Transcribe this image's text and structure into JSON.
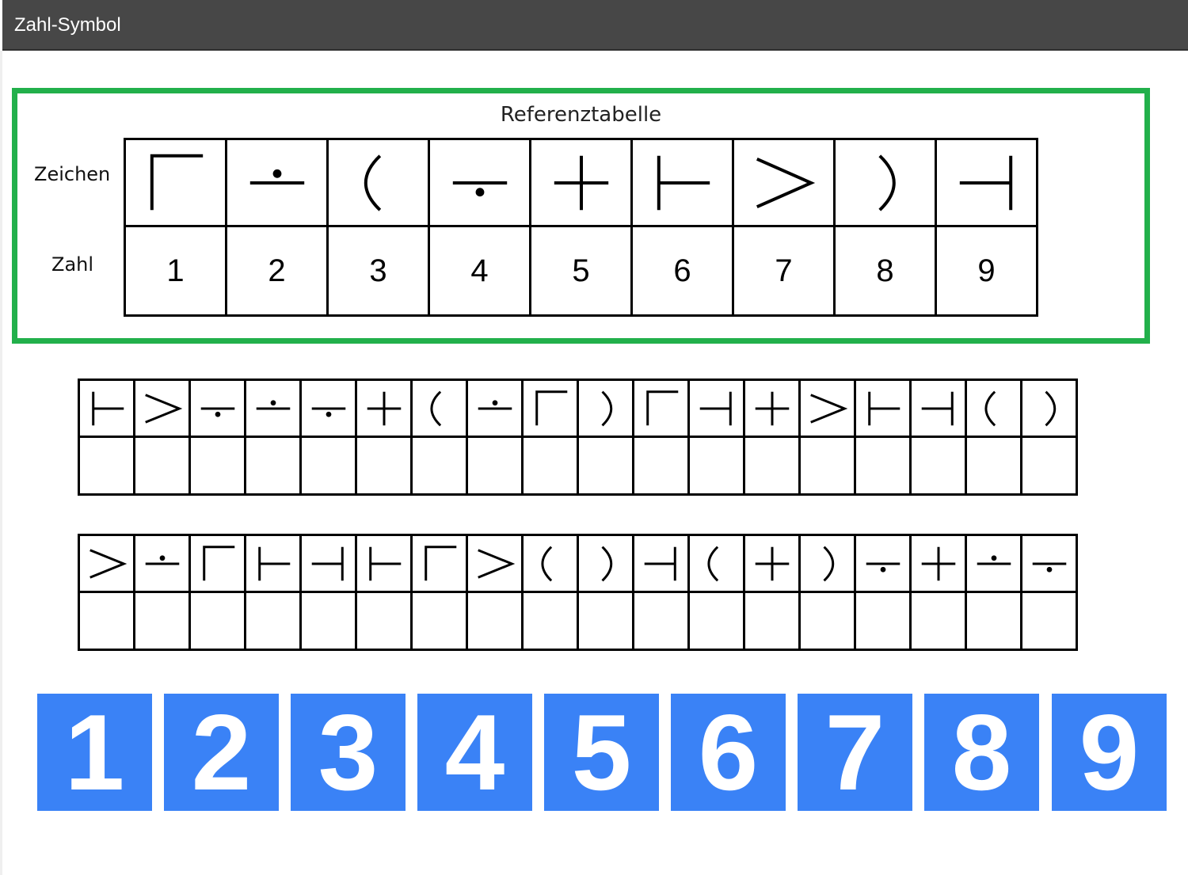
{
  "window": {
    "title": "Zahl-Symbol"
  },
  "reference": {
    "title": "Referenztabelle",
    "row_label_symbols": "Zeichen",
    "row_label_numbers": "Zahl",
    "pairs": [
      {
        "symbol": "corner-top-left",
        "number": "1"
      },
      {
        "symbol": "dot-above-line",
        "number": "2"
      },
      {
        "symbol": "open-paren",
        "number": "3"
      },
      {
        "symbol": "dot-below-line",
        "number": "4"
      },
      {
        "symbol": "plus",
        "number": "5"
      },
      {
        "symbol": "tee-right",
        "number": "6"
      },
      {
        "symbol": "greater-than",
        "number": "7"
      },
      {
        "symbol": "close-paren",
        "number": "8"
      },
      {
        "symbol": "tee-left",
        "number": "9"
      }
    ]
  },
  "task_rows": [
    {
      "symbols": [
        "tee-right",
        "greater-than",
        "dot-below-line",
        "dot-above-line",
        "dot-below-line",
        "plus",
        "open-paren",
        "dot-above-line",
        "corner-top-left",
        "close-paren",
        "corner-top-left",
        "tee-left",
        "plus",
        "greater-than",
        "tee-right",
        "tee-left",
        "open-paren",
        "close-paren"
      ],
      "answers": [
        "",
        "",
        "",
        "",
        "",
        "",
        "",
        "",
        "",
        "",
        "",
        "",
        "",
        "",
        "",
        "",
        "",
        ""
      ]
    },
    {
      "symbols": [
        "greater-than",
        "dot-above-line",
        "corner-top-left",
        "tee-right",
        "tee-left",
        "tee-right",
        "corner-top-left",
        "greater-than",
        "open-paren",
        "close-paren",
        "tee-left",
        "open-paren",
        "plus",
        "close-paren",
        "dot-below-line",
        "plus",
        "dot-above-line",
        "dot-below-line"
      ],
      "answers": [
        "",
        "",
        "",
        "",
        "",
        "",
        "",
        "",
        "",
        "",
        "",
        "",
        "",
        "",
        "",
        "",
        "",
        ""
      ]
    }
  ],
  "keypad": {
    "keys": [
      "1",
      "2",
      "3",
      "4",
      "5",
      "6",
      "7",
      "8",
      "9"
    ],
    "color": "#3a82f6"
  },
  "colors": {
    "reference_border": "#22b04b",
    "titlebar": "#474747"
  }
}
